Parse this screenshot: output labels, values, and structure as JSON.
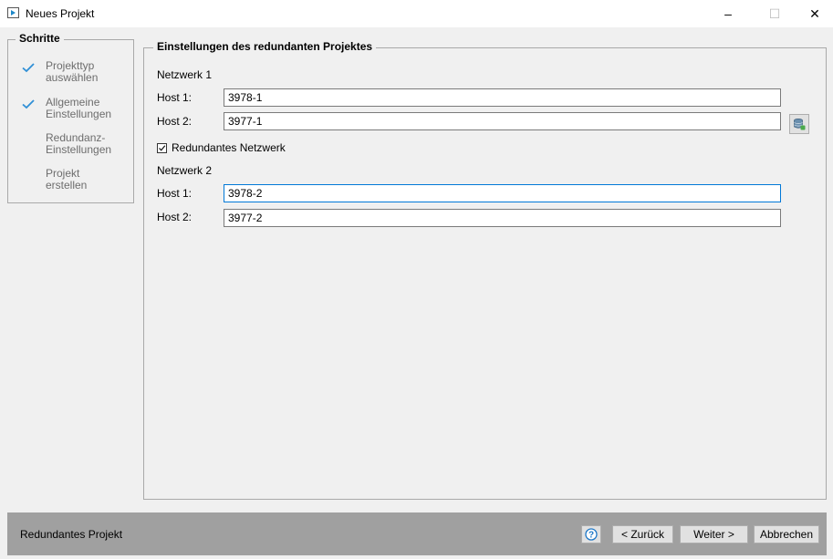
{
  "window": {
    "title": "Neues Projekt",
    "minimize_glyph": "–",
    "maximize_glyph": "☐",
    "close_glyph": "✕"
  },
  "steps": {
    "legend": "Schritte",
    "items": [
      {
        "line1": "Projekttyp",
        "line2": "auswählen",
        "done": true
      },
      {
        "line1": "Allgemeine",
        "line2": "Einstellungen",
        "done": true
      },
      {
        "line1": "Redundanz-",
        "line2": "Einstellungen",
        "done": false
      },
      {
        "line1": "Projekt",
        "line2": "erstellen",
        "done": false
      }
    ]
  },
  "settings": {
    "legend": "Einstellungen des redundanten Projektes",
    "network1": {
      "label": "Netzwerk 1",
      "host1_label": "Host 1:",
      "host1_value": "3978-1",
      "host2_label": "Host 2:",
      "host2_value": "3977-1"
    },
    "redundant_checkbox": {
      "label": "Redundantes Netzwerk",
      "checked": true
    },
    "network2": {
      "label": "Netzwerk 2",
      "host1_label": "Host 1:",
      "host1_value": "3978-2",
      "host2_label": "Host 2:",
      "host2_value": "3977-2"
    }
  },
  "footer": {
    "title": "Redundantes Projekt",
    "help_glyph": "?",
    "back_label": "< Zurück",
    "next_label": "Weiter >",
    "cancel_label": "Abbrechen"
  },
  "colors": {
    "check": "#2f8fd6",
    "focus_border": "#0078d7",
    "footer_bg": "#a0a0a0",
    "help_accent": "#1e78c8"
  }
}
